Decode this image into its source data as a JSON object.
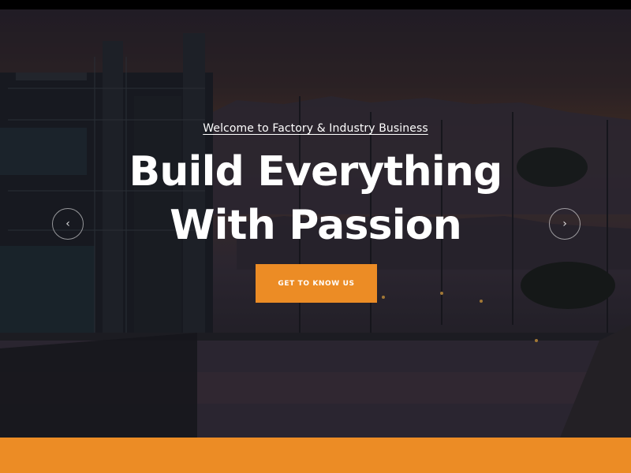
{
  "hero": {
    "tagline": "Welcome to Factory & Industry Business",
    "headline_line1": "Build Everything",
    "headline_line2": "With Passion",
    "cta_label": "GET TO KNOW US",
    "prev_arrow": "‹",
    "next_arrow": "›"
  },
  "colors": {
    "accent": "#ec8c25",
    "text": "#ffffff",
    "topbar": "#000000"
  },
  "icons": {
    "prev": "chevron-left-icon",
    "next": "chevron-right-icon"
  }
}
